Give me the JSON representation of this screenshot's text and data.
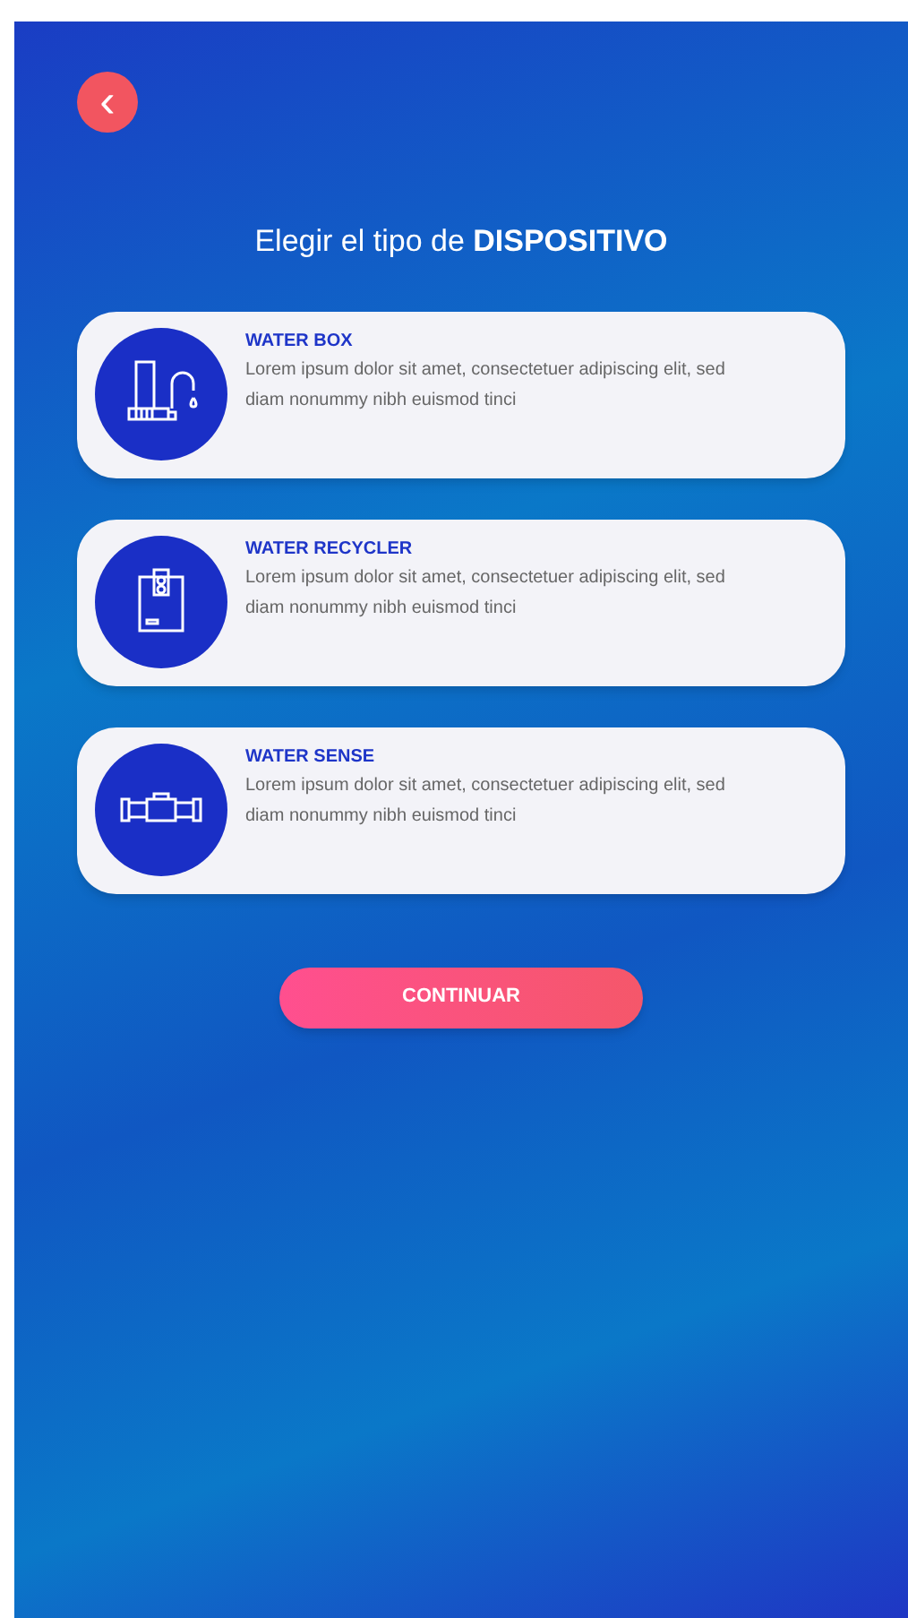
{
  "back_button": {
    "label": "‹"
  },
  "heading": "Elegir el tipo de **DISPOSITIVO**",
  "devices": [
    {
      "title": "WATER BOX",
      "description": "Lorem ipsum dolor sit amet, consectetuer adipiscing elit, sed diam nonummy nibh euismod tinci"
    },
    {
      "title": "WATER RECYCLER",
      "description": "Lorem ipsum dolor sit amet, consectetuer adipiscing elit, sed diam nonummy nibh euismod tinci"
    },
    {
      "title": "WATER SENSE",
      "description": "Lorem ipsum dolor sit amet, consectetuer adipiscing elit, sed diam nonummy nibh euismod tinci"
    }
  ],
  "continue_button": "CONTINUAR"
}
